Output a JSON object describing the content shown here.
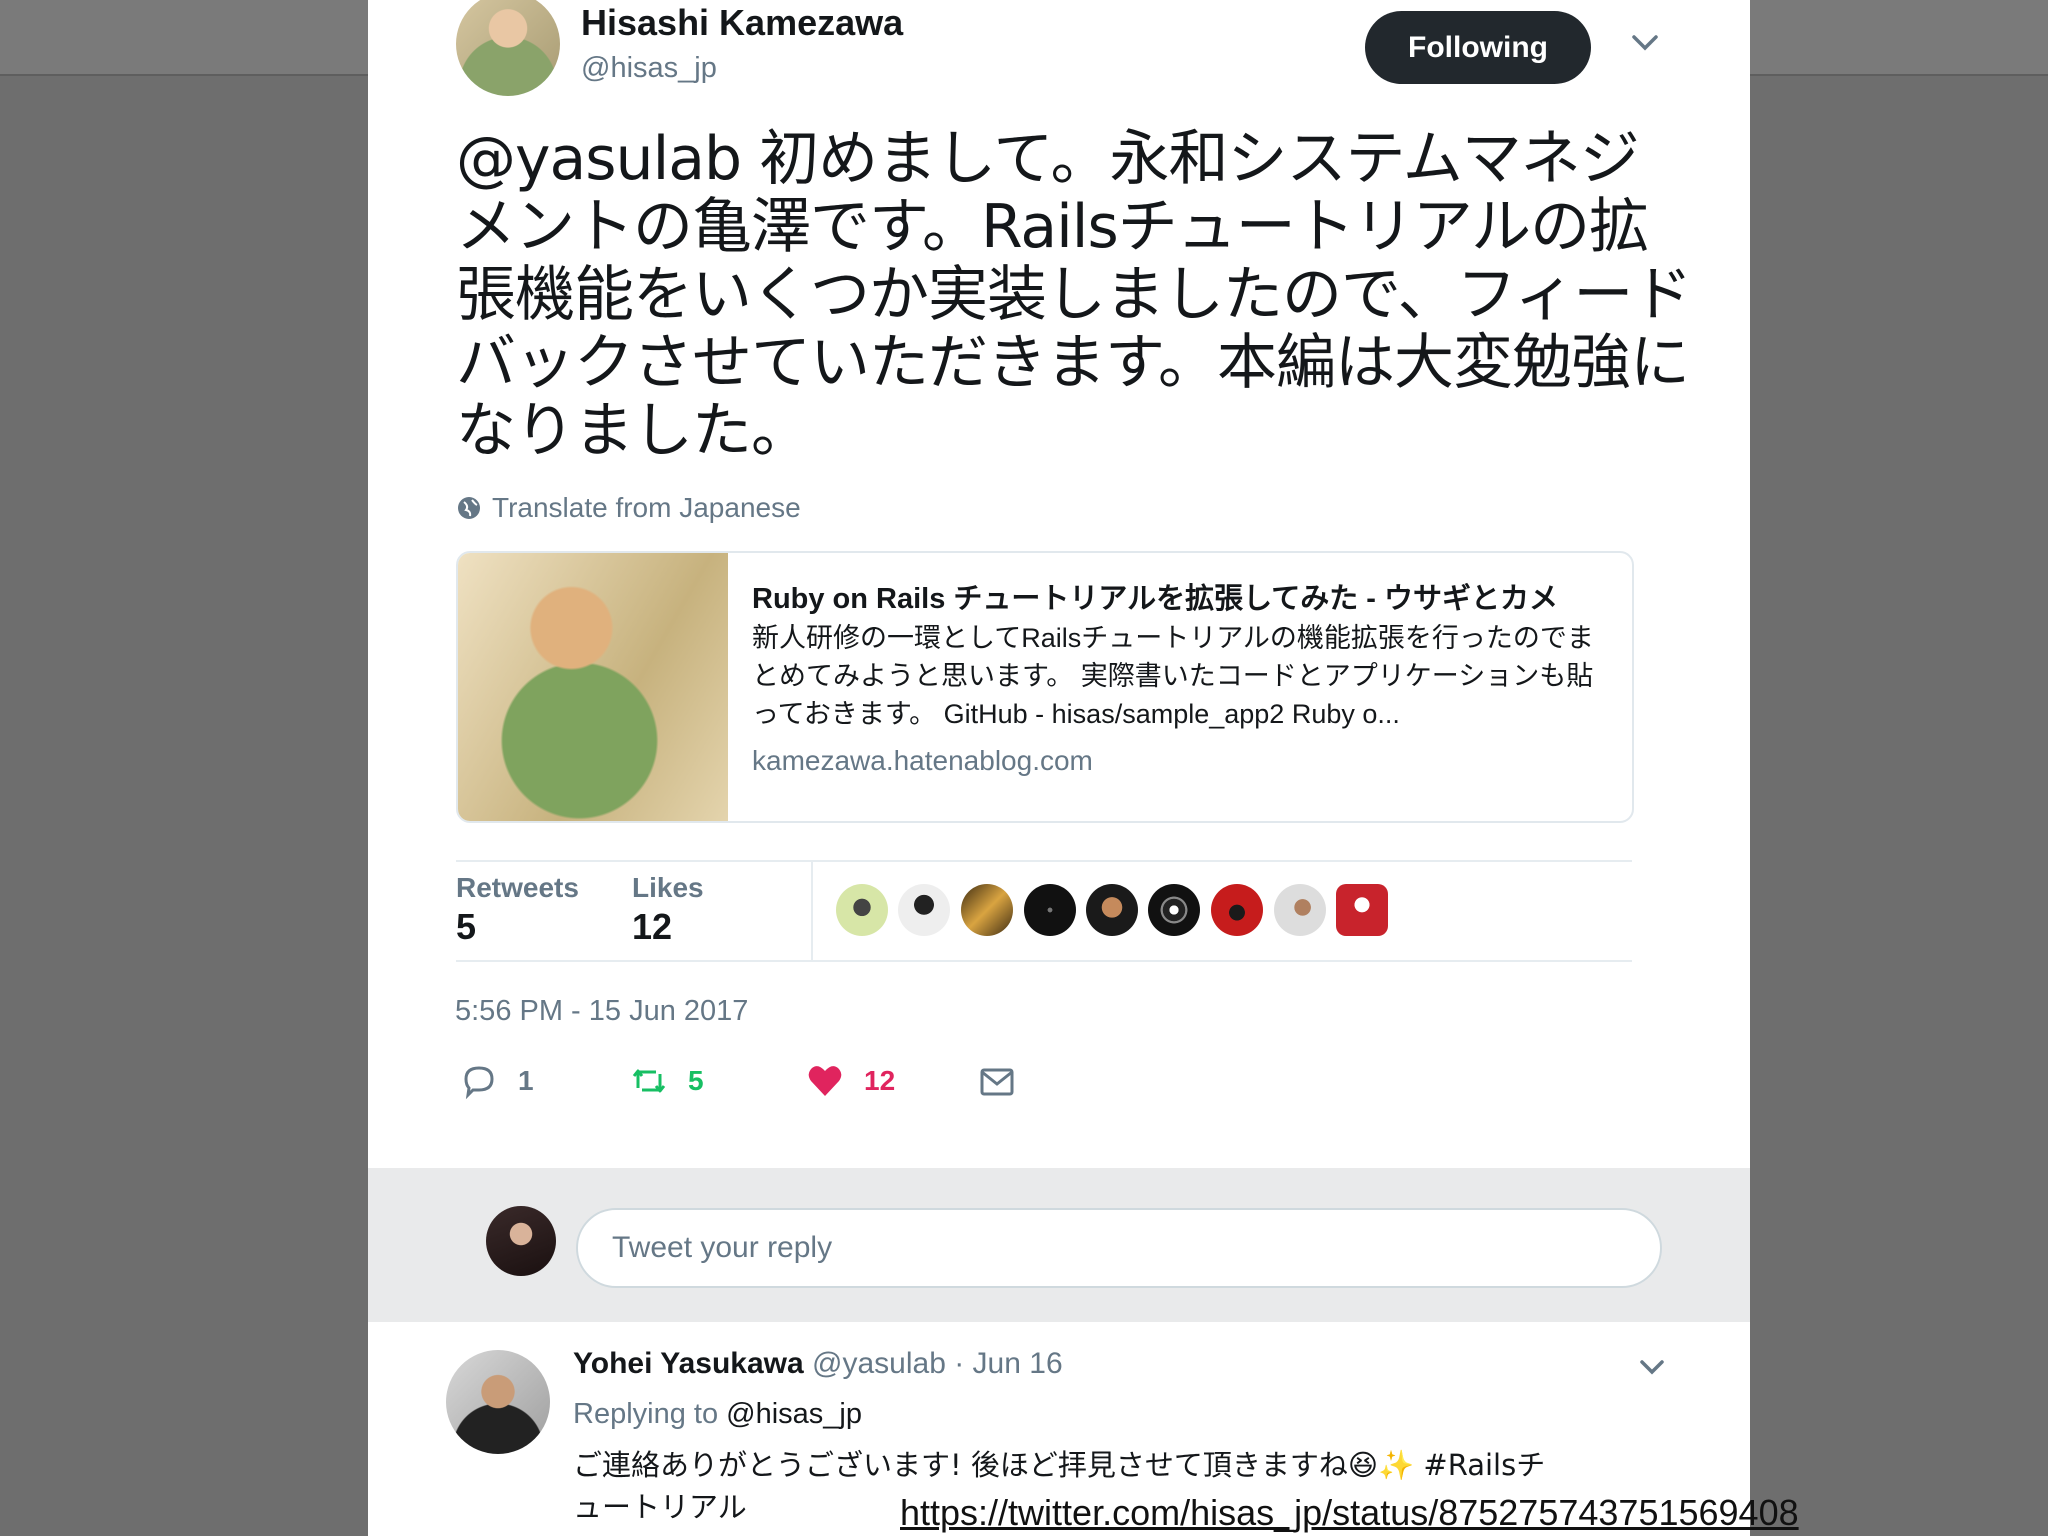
{
  "author": {
    "name": "Hisashi Kamezawa",
    "handle": "@hisas_jp"
  },
  "follow_button": "Following",
  "tweet": {
    "text": "@yasulab 初めまして。永和システムマネジメントの亀澤です。Railsチュートリアルの拡張機能をいくつか実装しましたので、フィードバックさせていただきます。本編は大変勉強になりました。",
    "translate": "Translate from Japanese",
    "timestamp": "5:56 PM - 15 Jun 2017"
  },
  "link_card": {
    "title": "Ruby on Rails チュートリアルを拡張してみた - ウサギとカメ",
    "description": "新人研修の一環としてRailsチュートリアルの機能拡張を行ったのでまとめてみようと思います。 実際書いたコードとアプリケーションも貼っておきます。 GitHub - hisas/sample_app2 Ruby o...",
    "domain": "kamezawa.hatenablog.com"
  },
  "stats": {
    "retweets_label": "Retweets",
    "retweets": "5",
    "likes_label": "Likes",
    "likes": "12"
  },
  "actions": {
    "replies": "1",
    "retweets": "5",
    "likes": "12"
  },
  "reply_box": {
    "placeholder": "Tweet your reply"
  },
  "reply": {
    "name": "Yohei Yasukawa",
    "handle_date": "@yasulab · Jun 16",
    "replying_label": "Replying to",
    "replying_to": "@hisas_jp",
    "text": "ご連絡ありがとうございます! 後ほど拝見させて頂きますね😆✨ #Railsチュートリアル"
  },
  "caption_url": "https://twitter.com/hisas_jp/status/875275743751569408",
  "colors": {
    "retweet": "#17bf63",
    "like": "#e0245e",
    "muted": "#657786"
  },
  "icons": [
    "chevron-down-icon",
    "globe-icon",
    "reply-icon",
    "retweet-icon",
    "heart-icon",
    "mail-icon"
  ]
}
